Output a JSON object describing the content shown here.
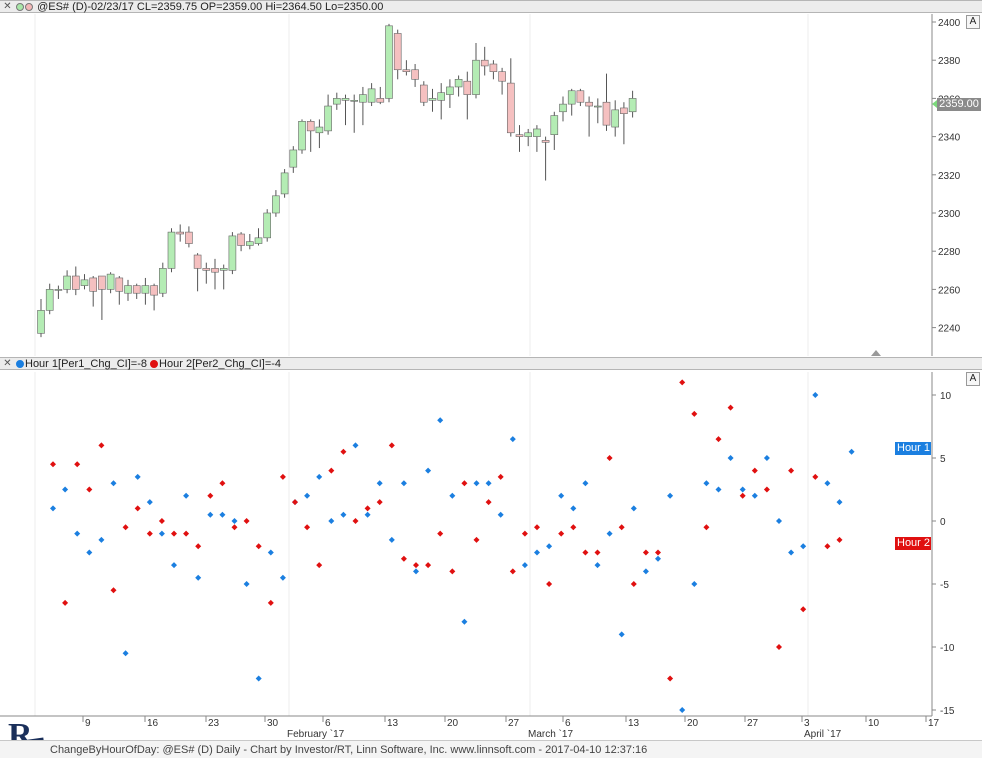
{
  "top_pane": {
    "title": "@ES# (D)-02/23/17 CL=2359.75 OP=2359.00 Hi=2364.50 Lo=2350.00",
    "autoscale_label": "A",
    "last_price_label": "2359.00",
    "y_ticks": [
      {
        "v": 2400,
        "label": "2400"
      },
      {
        "v": 2380,
        "label": "2380"
      },
      {
        "v": 2360,
        "label": "2360"
      },
      {
        "v": 2340,
        "label": "2340"
      },
      {
        "v": 2320,
        "label": "2320"
      },
      {
        "v": 2300,
        "label": "2300"
      },
      {
        "v": 2280,
        "label": "2280"
      },
      {
        "v": 2260,
        "label": "2260"
      },
      {
        "v": 2240,
        "label": "2240"
      }
    ]
  },
  "bottom_pane": {
    "title_part1": "Hour 1[Per1_Chg_CI]=-8",
    "title_part2": "Hour 2[Per2_Chg_CI]=-4",
    "autoscale_label": "A",
    "series_tag_1": "Hour 1",
    "series_tag_2": "Hour 2",
    "y_ticks": [
      {
        "v": 10,
        "label": "10"
      },
      {
        "v": 5,
        "label": "5"
      },
      {
        "v": 0,
        "label": "0"
      },
      {
        "v": -5,
        "label": "-5"
      },
      {
        "v": -10,
        "label": "-10"
      },
      {
        "v": -15,
        "label": "-15"
      }
    ]
  },
  "x_axis": {
    "day_labels": [
      "9",
      "16",
      "23",
      "30",
      "6",
      "13",
      "20",
      "27",
      "6",
      "13",
      "20",
      "27",
      "3",
      "10",
      "17"
    ],
    "month_labels": [
      "February `17",
      "March `17",
      "April `17"
    ]
  },
  "footer": {
    "text": "ChangeByHourOfDay: @ES# (D) Daily - Chart by Investor/RT, Linn Software, Inc. www.linnsoft.com - 2017-04-10 12:37:16"
  },
  "colors": {
    "up_candle": "#b4ecb4",
    "down_candle": "#f5c0c0",
    "hour1": "#1b7fe0",
    "hour2": "#e01010",
    "grid": "#eeeeee"
  },
  "chart_data": [
    {
      "type": "candlestick",
      "title": "@ES# (D)-02/23/17 CL=2359.75 OP=2359.00 Hi=2364.50 Lo=2350.00",
      "ylim": [
        2228,
        2404
      ],
      "candles": [
        {
          "o": 2237,
          "c": 2249,
          "h": 2255,
          "l": 2235
        },
        {
          "o": 2249,
          "c": 2260,
          "h": 2263,
          "l": 2247
        },
        {
          "o": 2260,
          "c": 2260,
          "h": 2262,
          "l": 2255
        },
        {
          "o": 2260,
          "c": 2267,
          "h": 2270,
          "l": 2258
        },
        {
          "o": 2267,
          "c": 2260,
          "h": 2272,
          "l": 2257
        },
        {
          "o": 2262,
          "c": 2265,
          "h": 2268,
          "l": 2260
        },
        {
          "o": 2266,
          "c": 2259,
          "h": 2267,
          "l": 2251
        },
        {
          "o": 2267,
          "c": 2260,
          "h": 2267,
          "l": 2244
        },
        {
          "o": 2260,
          "c": 2268,
          "h": 2269,
          "l": 2258
        },
        {
          "o": 2266,
          "c": 2259,
          "h": 2267,
          "l": 2252
        },
        {
          "o": 2258,
          "c": 2262,
          "h": 2265,
          "l": 2254
        },
        {
          "o": 2262,
          "c": 2258,
          "h": 2263,
          "l": 2255
        },
        {
          "o": 2258,
          "c": 2262,
          "h": 2266,
          "l": 2252
        },
        {
          "o": 2262,
          "c": 2257,
          "h": 2263,
          "l": 2249
        },
        {
          "o": 2258,
          "c": 2271,
          "h": 2274,
          "l": 2256
        },
        {
          "o": 2271,
          "c": 2290,
          "h": 2292,
          "l": 2269
        },
        {
          "o": 2290,
          "c": 2289,
          "h": 2294,
          "l": 2285
        },
        {
          "o": 2290,
          "c": 2284,
          "h": 2293,
          "l": 2282
        },
        {
          "o": 2278,
          "c": 2271,
          "h": 2279,
          "l": 2259
        },
        {
          "o": 2271,
          "c": 2270,
          "h": 2274,
          "l": 2263
        },
        {
          "o": 2271,
          "c": 2269,
          "h": 2276,
          "l": 2260
        },
        {
          "o": 2270,
          "c": 2271,
          "h": 2273,
          "l": 2260
        },
        {
          "o": 2270,
          "c": 2288,
          "h": 2290,
          "l": 2268
        },
        {
          "o": 2289,
          "c": 2283,
          "h": 2290,
          "l": 2280
        },
        {
          "o": 2283,
          "c": 2285,
          "h": 2289,
          "l": 2281
        },
        {
          "o": 2284,
          "c": 2287,
          "h": 2292,
          "l": 2283
        },
        {
          "o": 2287,
          "c": 2300,
          "h": 2302,
          "l": 2285
        },
        {
          "o": 2300,
          "c": 2309,
          "h": 2312,
          "l": 2298
        },
        {
          "o": 2310,
          "c": 2321,
          "h": 2323,
          "l": 2308
        },
        {
          "o": 2324,
          "c": 2333,
          "h": 2335,
          "l": 2321
        },
        {
          "o": 2333,
          "c": 2348,
          "h": 2349,
          "l": 2331
        },
        {
          "o": 2348,
          "c": 2343,
          "h": 2349,
          "l": 2332
        },
        {
          "o": 2342,
          "c": 2345,
          "h": 2349,
          "l": 2334
        },
        {
          "o": 2343,
          "c": 2356,
          "h": 2362,
          "l": 2341
        },
        {
          "o": 2357,
          "c": 2360,
          "h": 2363,
          "l": 2354
        },
        {
          "o": 2359,
          "c": 2360,
          "h": 2362,
          "l": 2346
        },
        {
          "o": 2359,
          "c": 2359,
          "h": 2362,
          "l": 2342
        },
        {
          "o": 2358,
          "c": 2362,
          "h": 2366,
          "l": 2346
        },
        {
          "o": 2358,
          "c": 2365,
          "h": 2368,
          "l": 2356
        },
        {
          "o": 2360,
          "c": 2358,
          "h": 2366,
          "l": 2357
        },
        {
          "o": 2360,
          "c": 2398,
          "h": 2399,
          "l": 2358
        },
        {
          "o": 2394,
          "c": 2375,
          "h": 2396,
          "l": 2370
        },
        {
          "o": 2375,
          "c": 2374,
          "h": 2380,
          "l": 2372
        },
        {
          "o": 2375,
          "c": 2370,
          "h": 2378,
          "l": 2366
        },
        {
          "o": 2367,
          "c": 2358,
          "h": 2369,
          "l": 2356
        },
        {
          "o": 2359,
          "c": 2360,
          "h": 2365,
          "l": 2353
        },
        {
          "o": 2359,
          "c": 2363,
          "h": 2368,
          "l": 2349
        },
        {
          "o": 2362,
          "c": 2366,
          "h": 2370,
          "l": 2355
        },
        {
          "o": 2366,
          "c": 2370,
          "h": 2372,
          "l": 2361
        },
        {
          "o": 2369,
          "c": 2362,
          "h": 2374,
          "l": 2349
        },
        {
          "o": 2362,
          "c": 2380,
          "h": 2389,
          "l": 2360
        },
        {
          "o": 2380,
          "c": 2377,
          "h": 2387,
          "l": 2372
        },
        {
          "o": 2378,
          "c": 2374,
          "h": 2380,
          "l": 2370
        },
        {
          "o": 2374,
          "c": 2369,
          "h": 2376,
          "l": 2362
        },
        {
          "o": 2368,
          "c": 2342,
          "h": 2381,
          "l": 2340
        },
        {
          "o": 2341,
          "c": 2340,
          "h": 2346,
          "l": 2332
        },
        {
          "o": 2340,
          "c": 2342,
          "h": 2344,
          "l": 2335
        },
        {
          "o": 2340,
          "c": 2344,
          "h": 2346,
          "l": 2332
        },
        {
          "o": 2338,
          "c": 2337,
          "h": 2340,
          "l": 2317
        },
        {
          "o": 2341,
          "c": 2351,
          "h": 2353,
          "l": 2333
        },
        {
          "o": 2353,
          "c": 2357,
          "h": 2361,
          "l": 2348
        },
        {
          "o": 2357,
          "c": 2364,
          "h": 2365,
          "l": 2351
        },
        {
          "o": 2364,
          "c": 2358,
          "h": 2365,
          "l": 2356
        },
        {
          "o": 2358,
          "c": 2356,
          "h": 2361,
          "l": 2340
        },
        {
          "o": 2356,
          "c": 2356,
          "h": 2360,
          "l": 2347
        },
        {
          "o": 2358,
          "c": 2346,
          "h": 2373,
          "l": 2343
        },
        {
          "o": 2345,
          "c": 2354,
          "h": 2359,
          "l": 2340
        },
        {
          "o": 2355,
          "c": 2352,
          "h": 2358,
          "l": 2336
        },
        {
          "o": 2353,
          "c": 2360,
          "h": 2364,
          "l": 2350
        }
      ]
    },
    {
      "type": "scatter",
      "title": "",
      "ylim": [
        -15.5,
        12
      ],
      "series": [
        {
          "name": "Hour 1[Per1_Chg_CI]",
          "values": [
            1,
            2.5,
            -1,
            -2.5,
            -1.5,
            3,
            -10.5,
            3.5,
            1.5,
            -1,
            -3.5,
            2,
            -4.5,
            0.5,
            0.5,
            0,
            -5,
            -12.5,
            -2.5,
            -4.5,
            1.5,
            2,
            3.5,
            0,
            0.5,
            6,
            0.5,
            3,
            -1.5,
            3,
            -4,
            4,
            8,
            2,
            -8,
            3,
            3,
            0.5,
            6.5,
            -3.5,
            -2.5,
            -2,
            2,
            1,
            3,
            -3.5,
            -1,
            -9,
            1,
            -4,
            -3,
            2,
            -15,
            -5,
            3,
            2.5,
            5,
            2.5,
            2,
            5,
            0,
            -2.5,
            -2,
            10,
            3,
            1.5,
            5.5
          ]
        },
        {
          "name": "Hour 2[Per2_Chg_CI]",
          "values": [
            4.5,
            -6.5,
            4.5,
            2.5,
            6,
            -5.5,
            -0.5,
            1,
            -1,
            0,
            -1,
            -1,
            -2,
            2,
            3,
            -0.5,
            0,
            -2,
            -6.5,
            3.5,
            1.5,
            -0.5,
            -3.5,
            4,
            5.5,
            0,
            1,
            1.5,
            6,
            -3,
            -3.5,
            -3.5,
            -1,
            -4,
            3,
            -1.5,
            1.5,
            3.5,
            -4,
            -1,
            -0.5,
            -5,
            -1,
            -0.5,
            -2.5,
            -2.5,
            5,
            -0.5,
            -5,
            -2.5,
            -2.5,
            -12.5,
            11,
            8.5,
            -0.5,
            6.5,
            9,
            2,
            4,
            2.5,
            -10,
            4,
            -7,
            3.5,
            -2,
            -1.5
          ]
        }
      ]
    }
  ]
}
